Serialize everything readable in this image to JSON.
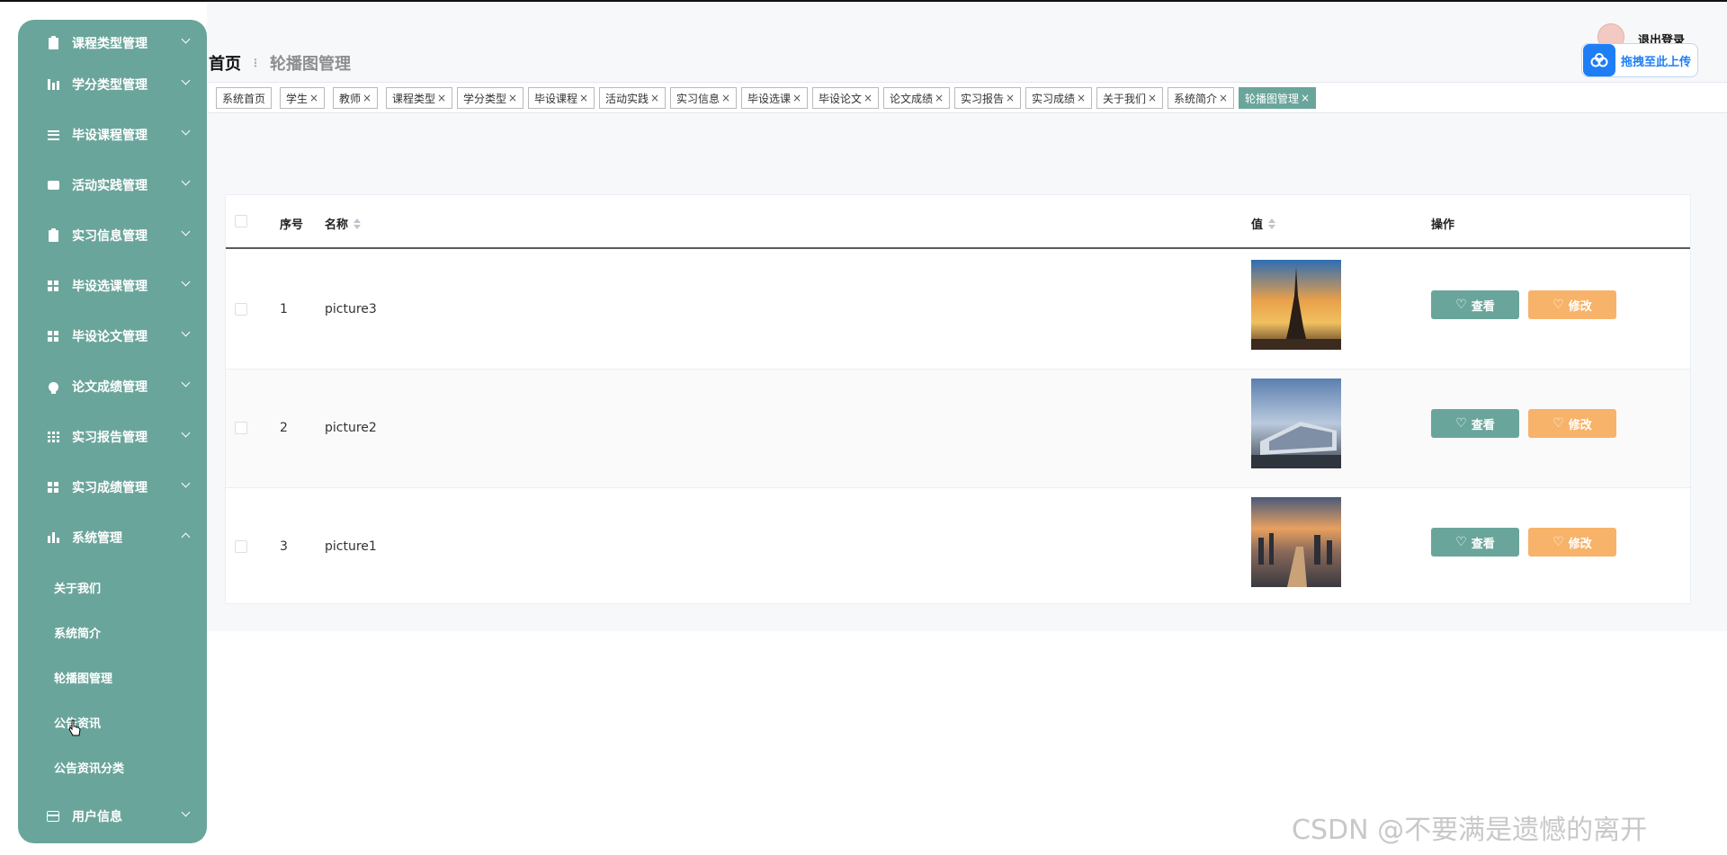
{
  "sidebar": {
    "items": [
      {
        "label": "课程类型管理",
        "icon": "clipboard-icon"
      },
      {
        "label": "学分类型管理",
        "icon": "bar-chart-icon"
      },
      {
        "label": "毕设课程管理",
        "icon": "list-icon"
      },
      {
        "label": "活动实践管理",
        "icon": "printer-icon"
      },
      {
        "label": "实习信息管理",
        "icon": "clipboard-x-icon"
      },
      {
        "label": "毕设选课管理",
        "icon": "grid-icon"
      },
      {
        "label": "毕设论文管理",
        "icon": "grid-icon"
      },
      {
        "label": "论文成绩管理",
        "icon": "bulb-icon"
      },
      {
        "label": "实习报告管理",
        "icon": "table-icon"
      },
      {
        "label": "实习成绩管理",
        "icon": "grid-icon"
      },
      {
        "label": "系统管理",
        "icon": "bar-chart-icon"
      }
    ],
    "sub_items": [
      "关于我们",
      "系统简介",
      "轮播图管理",
      "公告资讯",
      "公告资讯分类"
    ],
    "bottom_item": {
      "label": "用户信息",
      "icon": "card-icon"
    }
  },
  "header": {
    "breadcrumb_home": "首页",
    "breadcrumb_current": "轮播图管理",
    "logout": "退出登录",
    "upload": "拖拽至此上传"
  },
  "tabs": [
    {
      "label": "系统首页",
      "closable": false
    },
    {
      "label": "学生",
      "closable": true
    },
    {
      "label": "教师",
      "closable": true
    },
    {
      "label": "课程类型",
      "closable": true
    },
    {
      "label": "学分类型",
      "closable": true
    },
    {
      "label": "毕设课程",
      "closable": true
    },
    {
      "label": "活动实践",
      "closable": true
    },
    {
      "label": "实习信息",
      "closable": true
    },
    {
      "label": "毕设选课",
      "closable": true
    },
    {
      "label": "毕设论文",
      "closable": true
    },
    {
      "label": "论文成绩",
      "closable": true
    },
    {
      "label": "实习报告",
      "closable": true
    },
    {
      "label": "实习成绩",
      "closable": true
    },
    {
      "label": "关于我们",
      "closable": true
    },
    {
      "label": "系统简介",
      "closable": true
    },
    {
      "label": "轮播图管理",
      "closable": true,
      "active": true
    }
  ],
  "table": {
    "headers": {
      "index": "序号",
      "name": "名称",
      "value": "值",
      "actions": "操作"
    },
    "rows": [
      {
        "index": "1",
        "name": "picture3",
        "image": "eiffel-tower-sunset"
      },
      {
        "index": "2",
        "name": "picture2",
        "image": "modern-building-blue-sky"
      },
      {
        "index": "3",
        "name": "picture1",
        "image": "city-river-sunset"
      }
    ],
    "view_label": "查看",
    "edit_label": "修改"
  },
  "watermark": "CSDN @不要满是遗憾的离开",
  "colors": {
    "accent": "#6aa59b",
    "edit": "#f7b36a",
    "upload": "#1e7ef6"
  }
}
